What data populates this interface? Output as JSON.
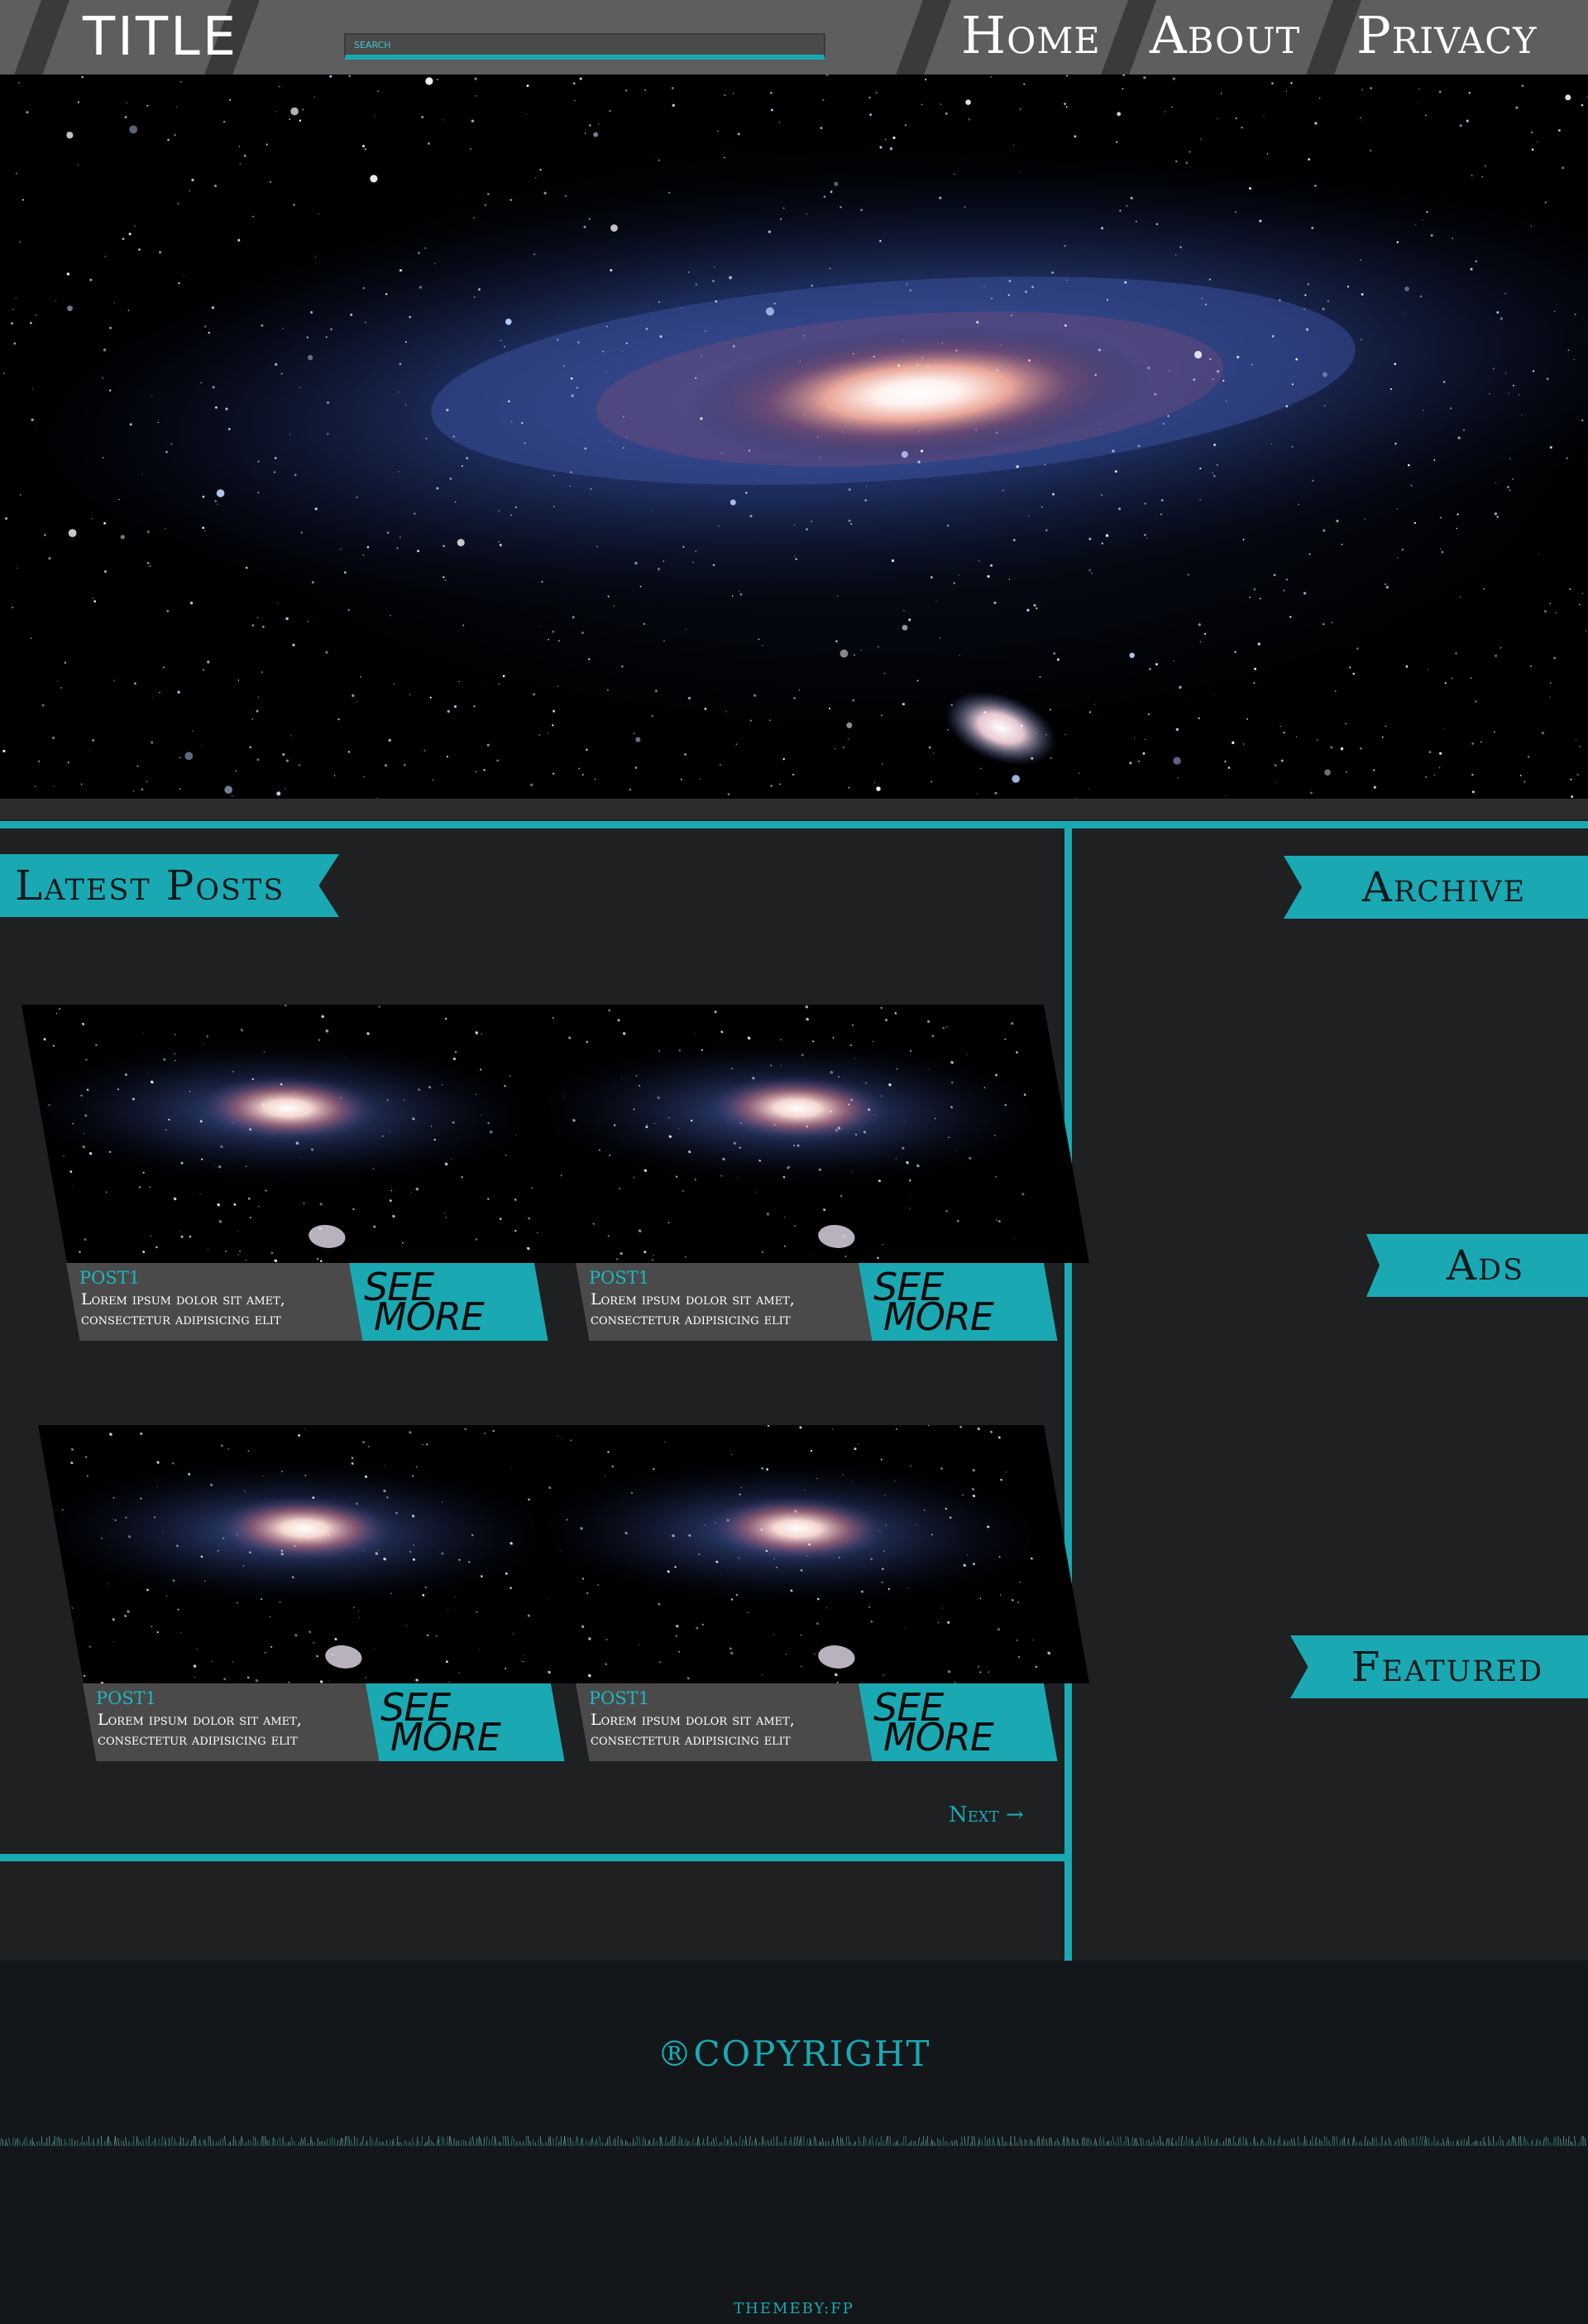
{
  "header": {
    "title": "TITLE",
    "search_placeholder": "SEARCH",
    "nav": [
      {
        "label": "Home"
      },
      {
        "label": "About"
      },
      {
        "label": "Privacy"
      }
    ]
  },
  "main": {
    "latest_heading": "Latest Posts",
    "posts": [
      {
        "label": "POST1",
        "text": "Lorem ipsum dolor sit amet, consectetur adipisicing elit",
        "see": "SEE",
        "more": "MORE"
      },
      {
        "label": "POST1",
        "text": "Lorem ipsum dolor sit amet, consectetur adipisicing elit",
        "see": "SEE",
        "more": "MORE"
      },
      {
        "label": "POST1",
        "text": "Lorem ipsum dolor sit amet, consectetur adipisicing elit",
        "see": "SEE",
        "more": "MORE"
      },
      {
        "label": "POST1",
        "text": "Lorem ipsum dolor sit amet, consectetur adipisicing elit",
        "see": "SEE",
        "more": "MORE"
      }
    ],
    "next_label": "Next →"
  },
  "sidebar": {
    "archive": "Archive",
    "ads": "Ads",
    "featured": "Featured"
  },
  "footer": {
    "copyright": "®COPYRIGHT",
    "themeby": "THEMEBY:FP"
  },
  "colors": {
    "accent": "#1aa9b3",
    "header_bg": "#5e5e5e",
    "main_bg": "#1e2021",
    "footer_bg": "#131719"
  }
}
